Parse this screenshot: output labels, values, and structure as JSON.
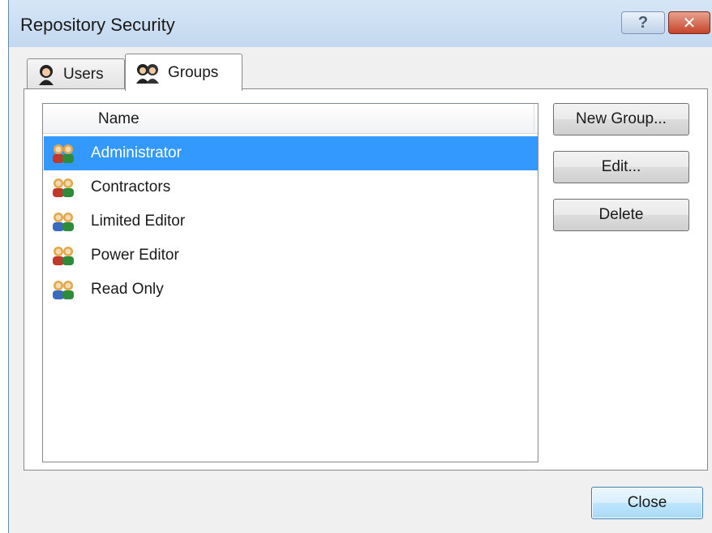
{
  "window": {
    "title": "Repository Security",
    "help_label": "?",
    "close_glyph": "✕"
  },
  "tabs": [
    {
      "label": "Users",
      "icon": "user-icon",
      "selected": false
    },
    {
      "label": "Groups",
      "icon": "group-icon",
      "selected": true
    }
  ],
  "list": {
    "column_header": "Name",
    "selected_color": "#3399ff",
    "rows": [
      {
        "label": "Administrator",
        "icon": "group-icon",
        "selected": true
      },
      {
        "label": "Contractors",
        "icon": "group-icon",
        "selected": false
      },
      {
        "label": "Limited Editor",
        "icon": "group-icon",
        "selected": false
      },
      {
        "label": "Power Editor",
        "icon": "group-icon",
        "selected": false
      },
      {
        "label": "Read Only",
        "icon": "group-icon",
        "selected": false
      }
    ]
  },
  "buttons": {
    "new_group": "New Group...",
    "edit": "Edit...",
    "delete": "Delete",
    "close": "Close"
  }
}
